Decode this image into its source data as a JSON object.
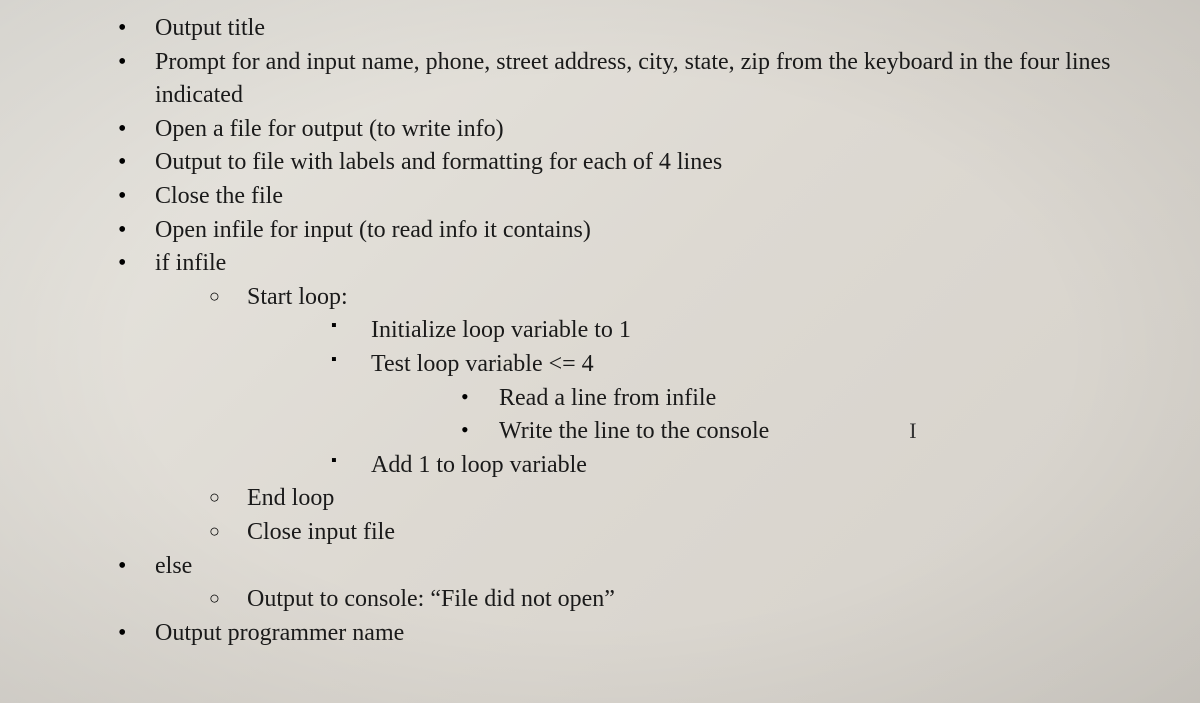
{
  "items": {
    "i1": "Output title",
    "i2": "Prompt for and input name, phone, street address, city, state, zip from the keyboard in the four lines indicated",
    "i3": "Open a file for output (to write info)",
    "i4": "Output to file with labels and formatting for each of 4 lines",
    "i5": "Close the file",
    "i6": "Open infile for input (to read info it contains)",
    "i7": "if infile",
    "i7a": "Start loop:",
    "i7a1": "Initialize loop variable to 1",
    "i7a2": "Test loop variable <= 4",
    "i7a2a": "Read a line from infile",
    "i7a2b": "Write the line to the console",
    "i7a3": "Add 1 to loop variable",
    "i7b": "End loop",
    "i7c": "Close input file",
    "i8": "else",
    "i8a": "Output to console: “File did not open”",
    "i9": "Output programmer name"
  },
  "cursor": "I"
}
